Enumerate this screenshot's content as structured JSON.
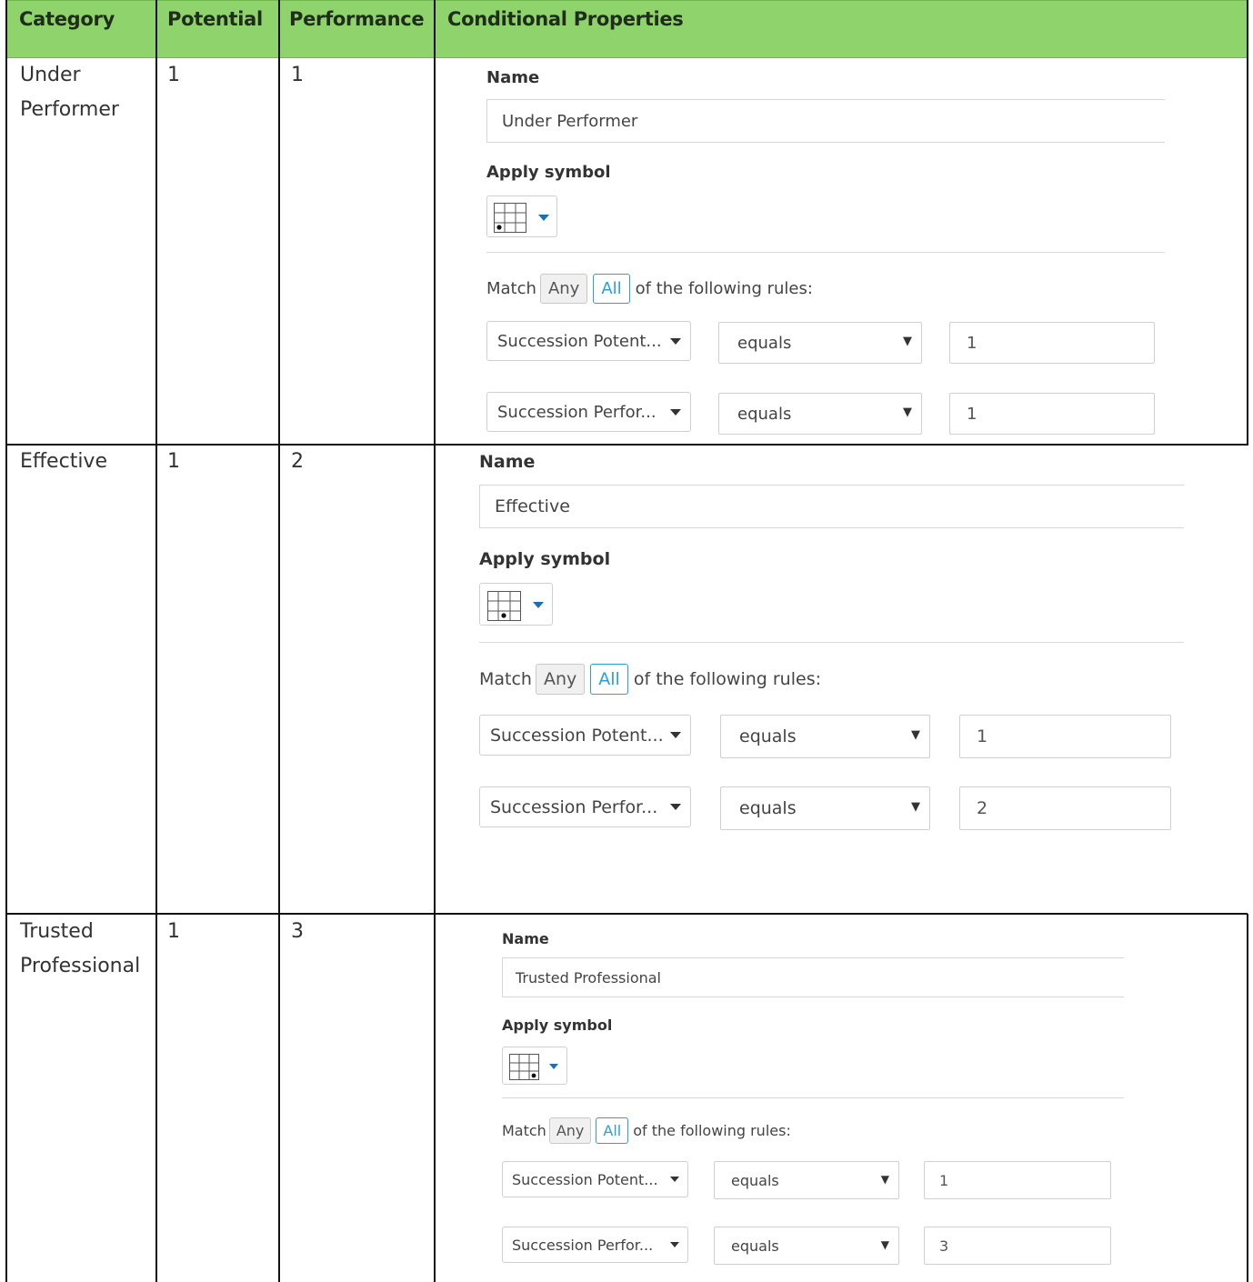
{
  "table": {
    "headers": [
      "Category",
      "Potential",
      "Performance",
      "Conditional Properties"
    ],
    "rows": [
      {
        "category_line1": "Under",
        "category_line2": "Performer",
        "potential": "1",
        "performance": "1"
      },
      {
        "category_line1": "Effective",
        "category_line2": "",
        "potential": "1",
        "performance": "2"
      },
      {
        "category_line1": "Trusted",
        "category_line2": "Professional",
        "potential": "1",
        "performance": "3"
      }
    ]
  },
  "forms": [
    {
      "name_label": "Name",
      "name_value": "Under Performer",
      "symbol_label": "Apply symbol",
      "match_prefix": "Match",
      "any_label": "Any",
      "all_label": "All",
      "match_suffix": "of the following rules:",
      "rules": [
        {
          "field": "Succession Potent...",
          "operator": "equals",
          "value": "1"
        },
        {
          "field": "Succession Perfor...",
          "operator": "equals",
          "value": "1"
        }
      ]
    },
    {
      "name_label": "Name",
      "name_value": "Effective",
      "symbol_label": "Apply symbol",
      "match_prefix": "Match",
      "any_label": "Any",
      "all_label": "All",
      "match_suffix": "of the following rules:",
      "rules": [
        {
          "field": "Succession Potent...",
          "operator": "equals",
          "value": "1"
        },
        {
          "field": "Succession Perfor...",
          "operator": "equals",
          "value": "2"
        }
      ]
    },
    {
      "name_label": "Name",
      "name_value": "Trusted Professional",
      "symbol_label": "Apply symbol",
      "match_prefix": "Match",
      "any_label": "Any",
      "all_label": "All",
      "match_suffix": "of the following rules:",
      "rules": [
        {
          "field": "Succession Potent...",
          "operator": "equals",
          "value": "1"
        },
        {
          "field": "Succession Perfor...",
          "operator": "equals",
          "value": "3"
        }
      ]
    }
  ],
  "colors": {
    "header_bg": "#8ed36c",
    "accent_blue": "#2a9fd8",
    "caret_blue": "#1a6fb5"
  },
  "icons": {
    "symbol": "grid-symbol-icon",
    "dropdown": "caret-down-icon"
  }
}
